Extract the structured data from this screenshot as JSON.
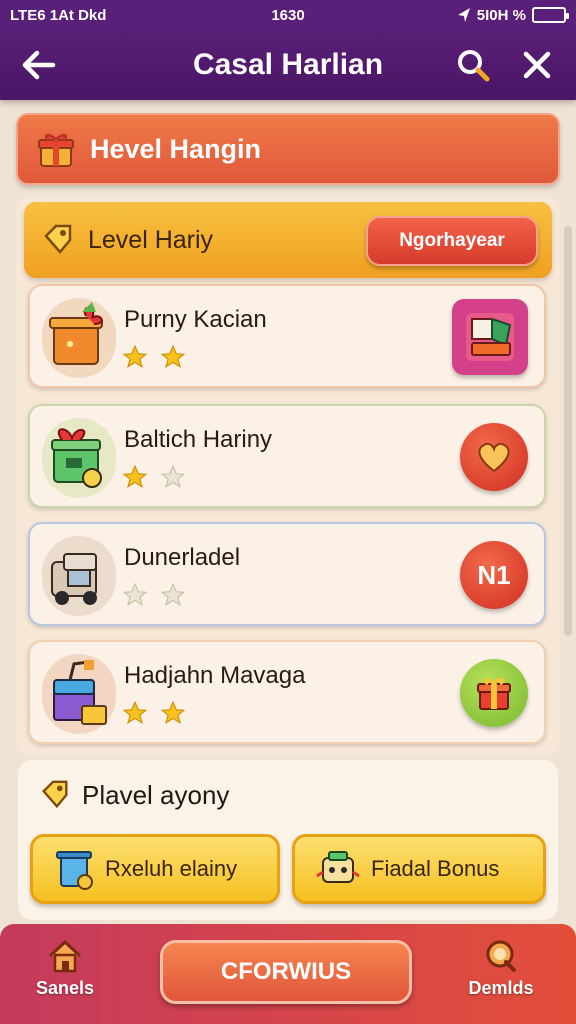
{
  "status_bar": {
    "left": "LTE6 1At Dkd",
    "time": "1630",
    "right": "5I0H %"
  },
  "header": {
    "title": "Casal Harlian"
  },
  "banner": {
    "label": "Hevel Hangin"
  },
  "level": {
    "label": "Level Hariy",
    "pill_label": "Ngorhayear"
  },
  "items": [
    {
      "name": "Purny Kacian",
      "stars_filled": 2,
      "stars_total": 2,
      "action": "puzzle-sticker-icon"
    },
    {
      "name": "Baltich Hariny",
      "stars_filled": 1,
      "stars_total": 2,
      "action": "heart-icon"
    },
    {
      "name": "Dunerladel",
      "stars_filled": 0,
      "stars_total": 2,
      "action_text": "N1"
    },
    {
      "name": "Hadjahn Mavaga",
      "stars_filled": 2,
      "stars_total": 2,
      "action": "gift-icon"
    }
  ],
  "play": {
    "title": "Plavel  ayony",
    "buttons": [
      {
        "label": "Rxeluh elainy"
      },
      {
        "label": "Fiadal Bonus"
      }
    ]
  },
  "bottom_nav": {
    "left_label": "Sanels",
    "center_label": "CFORWIUS",
    "right_label": "Demlds"
  },
  "colors": {
    "header_purple": "#5a1f78",
    "banner_orange": "#e0583a",
    "level_yellow": "#f0a020",
    "action_red": "#d63b2b",
    "action_green": "#8cc63f",
    "bottom_bar_start": "#c43a5c",
    "bottom_bar_end": "#e34e3a"
  }
}
